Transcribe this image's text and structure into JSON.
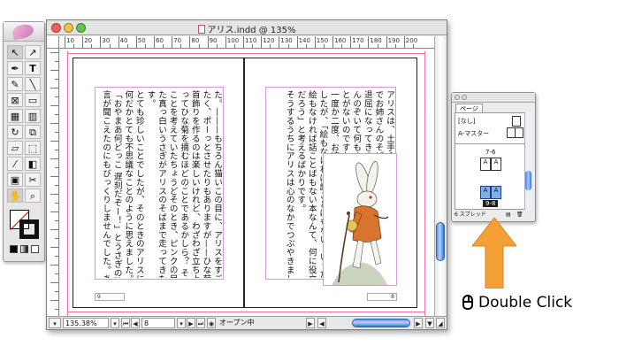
{
  "document_window": {
    "title": "アリス.indd @ 135%",
    "traffic_lights": [
      "#f0605a",
      "#f5c242",
      "#62c554"
    ],
    "ruler_marks": [
      "10",
      "20",
      "30",
      "40",
      "50",
      "60",
      "70",
      "80",
      "90",
      "100",
      "110",
      "120",
      "130",
      "140",
      "150",
      "160",
      "170",
      "180",
      "190",
      "200"
    ],
    "status": {
      "zoom": "135.38%",
      "page_field": "8",
      "state": "オープン中"
    }
  },
  "spread": {
    "left_page": {
      "text": "た。———もちろん猫いこの目に、アリスをすご眼\nたく、ポーっとさせたりもありますが——ひな菊の\n首飾りを作るのは楽しいけれど、わざわざ立ち上が\nってひな菊を摘むほどのことであるかしら？ そんな\nことを考えていたちょうどそのとき、ピンクの目をし\nた真っ白いうさぎがアリスのそばまで走ってきたので\nす。\nとても珍しいことでしたが、そのときのアリスには、\n何だかとても不思議なことのように思えました。だから\n「おやまあ何どっこ 遅刻だぞー！」とうさぎの独り\n言が聞こえたのにもびっくりしませんでした。あとか",
      "folio": "9"
    },
    "right_page": {
      "text": "アリスは、土手の上\nでお姉さんのそばに\n退屈になってきました\nんのぞいて何もする\nとがないのですから。\n一度か二度、お姉さんの読んでいる本をのぞき込んでみま\nしたが、「絵もなければ話ことばもない、いったい\n絵もなければ話ことばもない本なんて、何に役立つん\nだろう」と考えるばかりです。\nそうするうちにアリスは心のなかでつぶやきまし",
      "folio": "8"
    }
  },
  "pages_panel": {
    "tab": "ページ",
    "none_label": "[なし]",
    "master_label": "A-マスター",
    "spread_7_6": "7-6",
    "spread_9_8": "9-8",
    "footer": "6 スプレッド"
  },
  "annotation": {
    "label": "Double Click",
    "arrow_color": "#f5a034"
  }
}
